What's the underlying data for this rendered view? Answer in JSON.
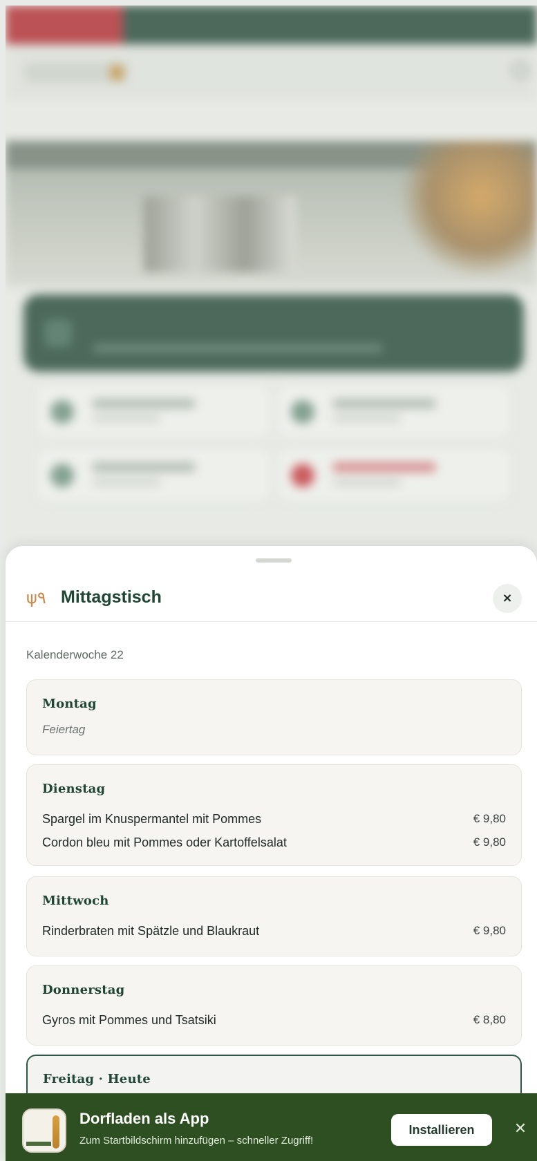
{
  "background_page": {
    "topbar_left_text": "",
    "title": "",
    "breadcrumb": "",
    "hero_heading": "",
    "banner_title": ""
  },
  "sheet": {
    "title": "Mittagstisch",
    "icon": "fork-knife-icon",
    "close_glyph": "×",
    "week_label": "Kalenderwoche 22",
    "days": [
      {
        "name": "Montag",
        "note": "Feiertag",
        "dishes": []
      },
      {
        "name": "Dienstag",
        "dishes": [
          {
            "name": "Spargel im Knuspermantel mit Pommes",
            "price": "€ 9,80"
          },
          {
            "name": "Cordon bleu mit Pommes oder Kartoffelsalat",
            "price": "€ 9,80"
          }
        ]
      },
      {
        "name": "Mittwoch",
        "dishes": [
          {
            "name": "Rinderbraten mit Spätzle und Blaukraut",
            "price": "€ 9,80"
          }
        ]
      },
      {
        "name": "Donnerstag",
        "dishes": [
          {
            "name": "Gyros mit Pommes und Tsatsiki",
            "price": "€ 8,80"
          }
        ]
      },
      {
        "name": "Freitag · Heute",
        "dishes": []
      }
    ]
  },
  "install_banner": {
    "title": "Dorfladen als App",
    "subtitle": "Zum Startbildschirm hinzufügen – schneller Zugriff!",
    "install_label": "Installieren",
    "close_glyph": "✕"
  },
  "colors": {
    "brand_green": "#1f4535",
    "banner_green": "#2d4f21",
    "accent_orange": "#c98a4b",
    "card_bg": "#f6f5f1"
  }
}
